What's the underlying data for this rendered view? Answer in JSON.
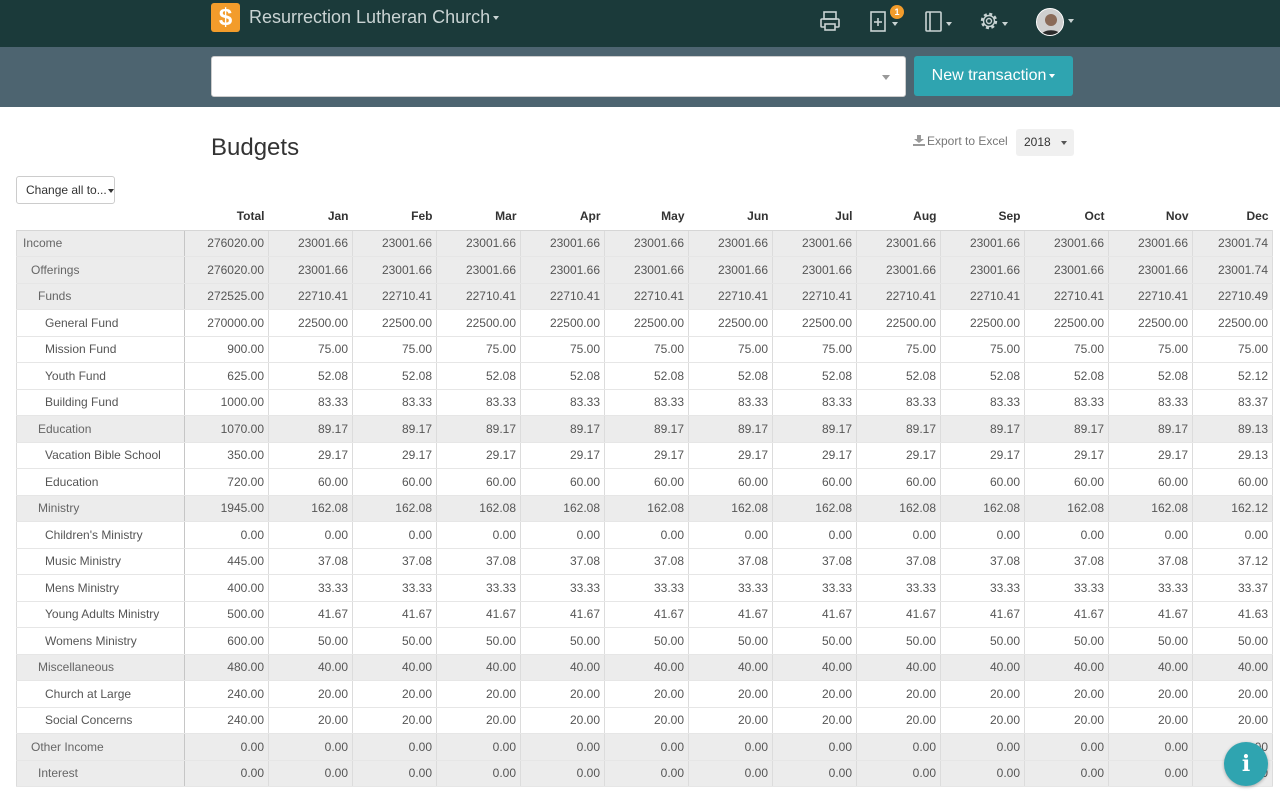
{
  "header": {
    "org_name": "Resurrection Lutheran Church",
    "logo_symbol": "$",
    "notification_count": "1",
    "icons": [
      "printer-icon",
      "add-document-icon",
      "notebook-icon",
      "gear-icon",
      "avatar"
    ],
    "colors": {
      "topbar": "#1b3a3a",
      "subbar": "#4d6470",
      "accent": "#2fa4b0",
      "badge": "#f39c2b"
    }
  },
  "toolbar": {
    "search_value": "",
    "new_transaction_label": "New transaction"
  },
  "page": {
    "title": "Budgets",
    "export_label": "Export to Excel",
    "year": "2018",
    "change_all_label": "Change all to..."
  },
  "table": {
    "columns": [
      "Total",
      "Jan",
      "Feb",
      "Mar",
      "Apr",
      "May",
      "Jun",
      "Jul",
      "Aug",
      "Sep",
      "Oct",
      "Nov",
      "Dec"
    ],
    "rows": [
      {
        "label": "Income",
        "level": 0,
        "group": true,
        "values": [
          "276020.00",
          "23001.66",
          "23001.66",
          "23001.66",
          "23001.66",
          "23001.66",
          "23001.66",
          "23001.66",
          "23001.66",
          "23001.66",
          "23001.66",
          "23001.66",
          "23001.74"
        ]
      },
      {
        "label": "Offerings",
        "level": 1,
        "group": true,
        "values": [
          "276020.00",
          "23001.66",
          "23001.66",
          "23001.66",
          "23001.66",
          "23001.66",
          "23001.66",
          "23001.66",
          "23001.66",
          "23001.66",
          "23001.66",
          "23001.66",
          "23001.74"
        ]
      },
      {
        "label": "Funds",
        "level": 2,
        "group": true,
        "values": [
          "272525.00",
          "22710.41",
          "22710.41",
          "22710.41",
          "22710.41",
          "22710.41",
          "22710.41",
          "22710.41",
          "22710.41",
          "22710.41",
          "22710.41",
          "22710.41",
          "22710.49"
        ]
      },
      {
        "label": "General Fund",
        "level": 3,
        "group": false,
        "values": [
          "270000.00",
          "22500.00",
          "22500.00",
          "22500.00",
          "22500.00",
          "22500.00",
          "22500.00",
          "22500.00",
          "22500.00",
          "22500.00",
          "22500.00",
          "22500.00",
          "22500.00"
        ]
      },
      {
        "label": "Mission Fund",
        "level": 3,
        "group": false,
        "values": [
          "900.00",
          "75.00",
          "75.00",
          "75.00",
          "75.00",
          "75.00",
          "75.00",
          "75.00",
          "75.00",
          "75.00",
          "75.00",
          "75.00",
          "75.00"
        ]
      },
      {
        "label": "Youth Fund",
        "level": 3,
        "group": false,
        "values": [
          "625.00",
          "52.08",
          "52.08",
          "52.08",
          "52.08",
          "52.08",
          "52.08",
          "52.08",
          "52.08",
          "52.08",
          "52.08",
          "52.08",
          "52.12"
        ]
      },
      {
        "label": "Building Fund",
        "level": 3,
        "group": false,
        "values": [
          "1000.00",
          "83.33",
          "83.33",
          "83.33",
          "83.33",
          "83.33",
          "83.33",
          "83.33",
          "83.33",
          "83.33",
          "83.33",
          "83.33",
          "83.37"
        ]
      },
      {
        "label": "Education",
        "level": 2,
        "group": true,
        "values": [
          "1070.00",
          "89.17",
          "89.17",
          "89.17",
          "89.17",
          "89.17",
          "89.17",
          "89.17",
          "89.17",
          "89.17",
          "89.17",
          "89.17",
          "89.13"
        ]
      },
      {
        "label": "Vacation Bible School",
        "level": 3,
        "group": false,
        "values": [
          "350.00",
          "29.17",
          "29.17",
          "29.17",
          "29.17",
          "29.17",
          "29.17",
          "29.17",
          "29.17",
          "29.17",
          "29.17",
          "29.17",
          "29.13"
        ]
      },
      {
        "label": "Education",
        "level": 3,
        "group": false,
        "values": [
          "720.00",
          "60.00",
          "60.00",
          "60.00",
          "60.00",
          "60.00",
          "60.00",
          "60.00",
          "60.00",
          "60.00",
          "60.00",
          "60.00",
          "60.00"
        ]
      },
      {
        "label": "Ministry",
        "level": 2,
        "group": true,
        "values": [
          "1945.00",
          "162.08",
          "162.08",
          "162.08",
          "162.08",
          "162.08",
          "162.08",
          "162.08",
          "162.08",
          "162.08",
          "162.08",
          "162.08",
          "162.12"
        ]
      },
      {
        "label": "Children's Ministry",
        "level": 3,
        "group": false,
        "values": [
          "0.00",
          "0.00",
          "0.00",
          "0.00",
          "0.00",
          "0.00",
          "0.00",
          "0.00",
          "0.00",
          "0.00",
          "0.00",
          "0.00",
          "0.00"
        ]
      },
      {
        "label": "Music Ministry",
        "level": 3,
        "group": false,
        "values": [
          "445.00",
          "37.08",
          "37.08",
          "37.08",
          "37.08",
          "37.08",
          "37.08",
          "37.08",
          "37.08",
          "37.08",
          "37.08",
          "37.08",
          "37.12"
        ]
      },
      {
        "label": "Mens Ministry",
        "level": 3,
        "group": false,
        "values": [
          "400.00",
          "33.33",
          "33.33",
          "33.33",
          "33.33",
          "33.33",
          "33.33",
          "33.33",
          "33.33",
          "33.33",
          "33.33",
          "33.33",
          "33.37"
        ]
      },
      {
        "label": "Young Adults Ministry",
        "level": 3,
        "group": false,
        "values": [
          "500.00",
          "41.67",
          "41.67",
          "41.67",
          "41.67",
          "41.67",
          "41.67",
          "41.67",
          "41.67",
          "41.67",
          "41.67",
          "41.67",
          "41.63"
        ]
      },
      {
        "label": "Womens Ministry",
        "level": 3,
        "group": false,
        "values": [
          "600.00",
          "50.00",
          "50.00",
          "50.00",
          "50.00",
          "50.00",
          "50.00",
          "50.00",
          "50.00",
          "50.00",
          "50.00",
          "50.00",
          "50.00"
        ]
      },
      {
        "label": "Miscellaneous",
        "level": 2,
        "group": true,
        "values": [
          "480.00",
          "40.00",
          "40.00",
          "40.00",
          "40.00",
          "40.00",
          "40.00",
          "40.00",
          "40.00",
          "40.00",
          "40.00",
          "40.00",
          "40.00"
        ]
      },
      {
        "label": "Church at Large",
        "level": 3,
        "group": false,
        "values": [
          "240.00",
          "20.00",
          "20.00",
          "20.00",
          "20.00",
          "20.00",
          "20.00",
          "20.00",
          "20.00",
          "20.00",
          "20.00",
          "20.00",
          "20.00"
        ]
      },
      {
        "label": "Social Concerns",
        "level": 3,
        "group": false,
        "values": [
          "240.00",
          "20.00",
          "20.00",
          "20.00",
          "20.00",
          "20.00",
          "20.00",
          "20.00",
          "20.00",
          "20.00",
          "20.00",
          "20.00",
          "20.00"
        ]
      },
      {
        "label": "Other Income",
        "level": 1,
        "group": true,
        "values": [
          "0.00",
          "0.00",
          "0.00",
          "0.00",
          "0.00",
          "0.00",
          "0.00",
          "0.00",
          "0.00",
          "0.00",
          "0.00",
          "0.00",
          "0.00"
        ]
      },
      {
        "label": "Interest",
        "level": 2,
        "group": true,
        "values": [
          "0.00",
          "0.00",
          "0.00",
          "0.00",
          "0.00",
          "0.00",
          "0.00",
          "0.00",
          "0.00",
          "0.00",
          "0.00",
          "0.00",
          "0.00"
        ]
      }
    ]
  },
  "help": {
    "info_symbol": "i"
  }
}
